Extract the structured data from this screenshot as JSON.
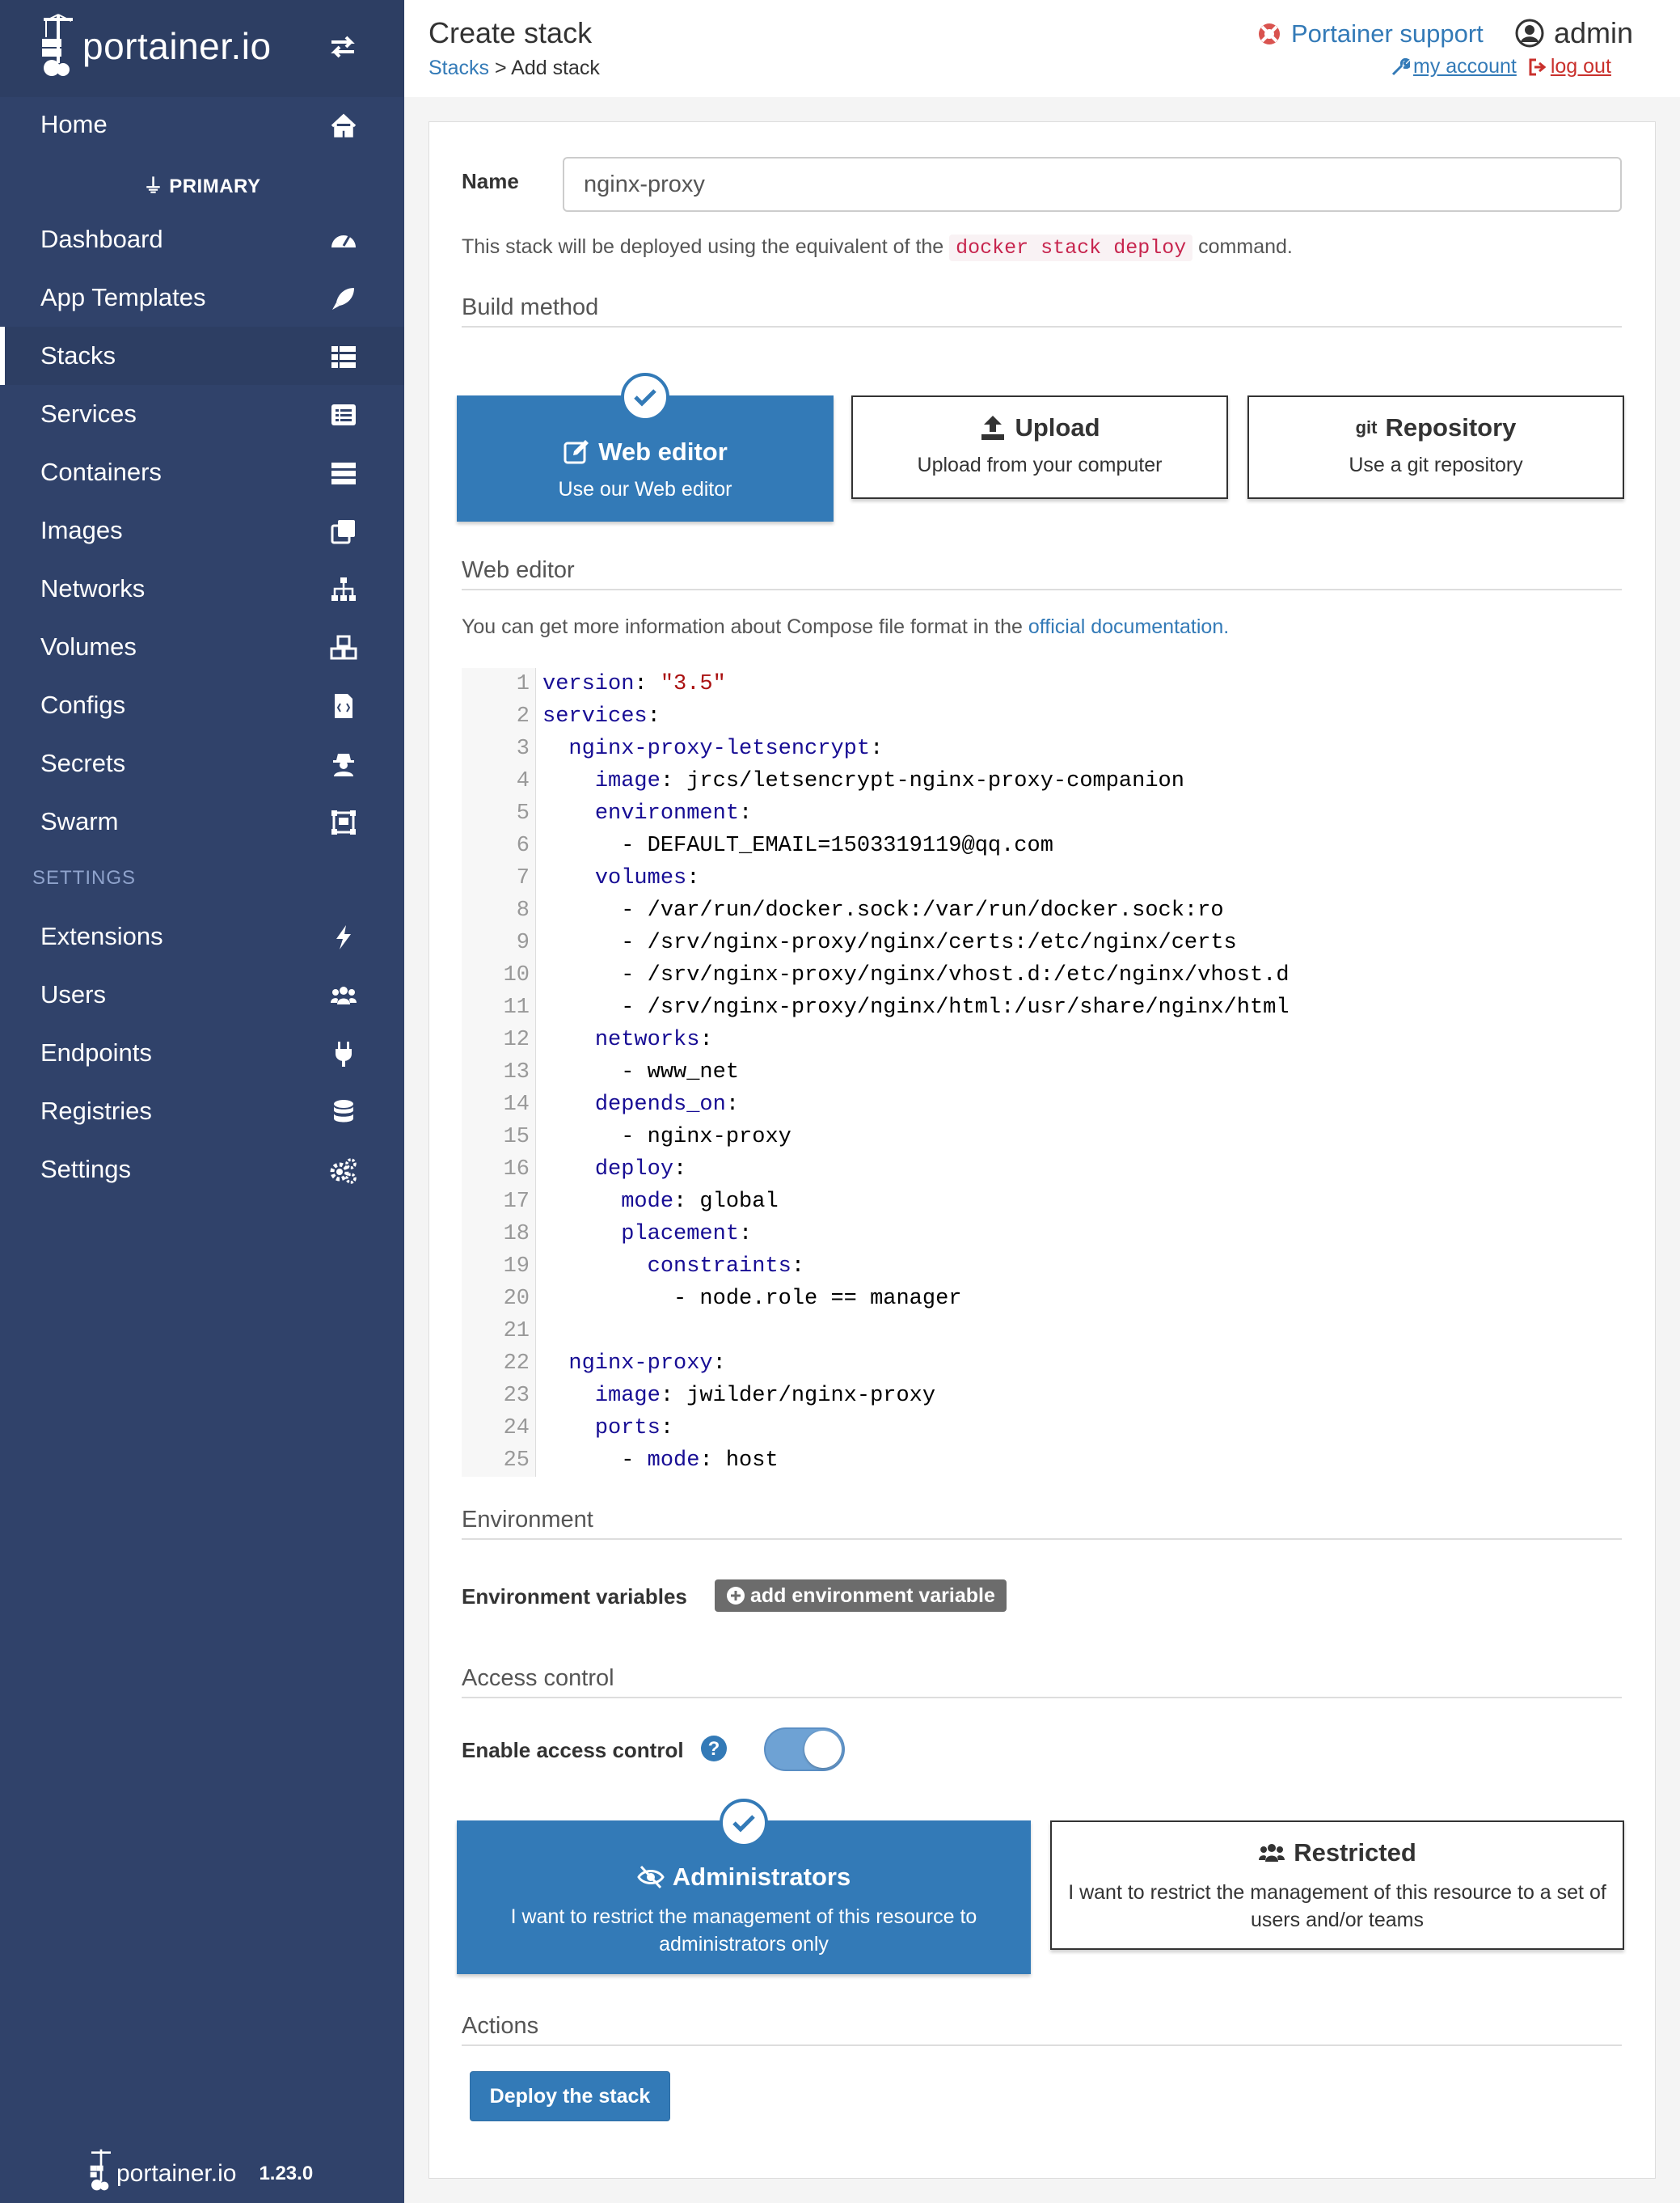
{
  "sidebar": {
    "brand": "portainer.io",
    "endpoint_label": "PRIMARY",
    "settings_heading": "SETTINGS",
    "items": [
      {
        "label": "Home",
        "icon": "home-icon"
      },
      {
        "label": "Dashboard",
        "icon": "tachometer-icon"
      },
      {
        "label": "App Templates",
        "icon": "rocket-icon"
      },
      {
        "label": "Stacks",
        "icon": "th-list-icon"
      },
      {
        "label": "Services",
        "icon": "list-alt-icon"
      },
      {
        "label": "Containers",
        "icon": "server-icon"
      },
      {
        "label": "Images",
        "icon": "clone-icon"
      },
      {
        "label": "Networks",
        "icon": "sitemap-icon"
      },
      {
        "label": "Volumes",
        "icon": "cubes-icon"
      },
      {
        "label": "Configs",
        "icon": "file-code-icon"
      },
      {
        "label": "Secrets",
        "icon": "user-secret-icon"
      },
      {
        "label": "Swarm",
        "icon": "object-group-icon"
      },
      {
        "label": "Extensions",
        "icon": "bolt-icon"
      },
      {
        "label": "Users",
        "icon": "users-icon"
      },
      {
        "label": "Endpoints",
        "icon": "plug-icon"
      },
      {
        "label": "Registries",
        "icon": "database-icon"
      },
      {
        "label": "Settings",
        "icon": "cogs-icon"
      }
    ],
    "active_item": "Stacks",
    "footer_brand": "portainer.io",
    "version": "1.23.0"
  },
  "header": {
    "title": "Create stack",
    "breadcrumb_link": "Stacks",
    "breadcrumb_current": " > Add stack",
    "support_label": "Portainer support",
    "user_name": "admin",
    "my_account": " my account ",
    "log_out": " log out"
  },
  "form": {
    "name_label": "Name",
    "name_value": "nginx-proxy",
    "deploy_hint_before": "This stack will be deployed using the equivalent of the",
    "deploy_hint_code": "docker stack deploy",
    "deploy_hint_after": "command."
  },
  "build_method": {
    "title": "Build method",
    "options": [
      {
        "label": "Web editor",
        "sub": "Use our Web editor",
        "icon": "edit-icon",
        "selected": true
      },
      {
        "label": "Upload",
        "sub": "Upload from your computer",
        "icon": "upload-icon",
        "selected": false
      },
      {
        "label": "Repository",
        "sub": "Use a git repository",
        "icon": "git-icon",
        "icon_text": "git",
        "selected": false
      }
    ]
  },
  "web_editor": {
    "title": "Web editor",
    "info_before": "You can get more information about Compose file format in the",
    "info_link": "official documentation.",
    "lines": [
      "1",
      "2",
      "3",
      "4",
      "5",
      "6",
      "7",
      "8",
      "9",
      "10",
      "11",
      "12",
      "13",
      "14",
      "15",
      "16",
      "17",
      "18",
      "19",
      "20",
      "21",
      "22",
      "23",
      "24",
      "25"
    ],
    "code": [
      {
        "k": "version",
        "rest": ": ",
        "s": "\"3.5\"",
        "indent": ""
      },
      {
        "k": "services",
        "rest": ":",
        "indent": ""
      },
      {
        "k": "nginx-proxy-letsencrypt",
        "rest": ":",
        "indent": "  "
      },
      {
        "k": "image",
        "rest": ": jrcs/letsencrypt-nginx-proxy-companion",
        "indent": "    "
      },
      {
        "k": "environment",
        "rest": ":",
        "indent": "    "
      },
      {
        "k": "",
        "rest": "- DEFAULT_EMAIL=1503319119@qq.com",
        "indent": "      "
      },
      {
        "k": "volumes",
        "rest": ":",
        "indent": "    "
      },
      {
        "k": "",
        "rest": "- /var/run/docker.sock:/var/run/docker.sock:ro",
        "indent": "      "
      },
      {
        "k": "",
        "rest": "- /srv/nginx-proxy/nginx/certs:/etc/nginx/certs",
        "indent": "      "
      },
      {
        "k": "",
        "rest": "- /srv/nginx-proxy/nginx/vhost.d:/etc/nginx/vhost.d",
        "indent": "      "
      },
      {
        "k": "",
        "rest": "- /srv/nginx-proxy/nginx/html:/usr/share/nginx/html",
        "indent": "      "
      },
      {
        "k": "networks",
        "rest": ":",
        "indent": "    "
      },
      {
        "k": "",
        "rest": "- www_net",
        "indent": "      "
      },
      {
        "k": "depends_on",
        "rest": ":",
        "indent": "    "
      },
      {
        "k": "",
        "rest": "- nginx-proxy",
        "indent": "      "
      },
      {
        "k": "deploy",
        "rest": ":",
        "indent": "    "
      },
      {
        "k": "mode",
        "rest": ": global",
        "indent": "      "
      },
      {
        "k": "placement",
        "rest": ":",
        "indent": "      "
      },
      {
        "k": "constraints",
        "rest": ":",
        "indent": "        "
      },
      {
        "k": "",
        "rest": "- node.role == manager",
        "indent": "          "
      },
      {
        "k": "",
        "rest": "",
        "indent": ""
      },
      {
        "k": "nginx-proxy",
        "rest": ":",
        "indent": "  "
      },
      {
        "k": "image",
        "rest": ": jwilder/nginx-proxy",
        "indent": "    "
      },
      {
        "k": "ports",
        "rest": ":",
        "indent": "    "
      },
      {
        "k": "mode",
        "rest": ": host",
        "indent": "      ",
        "dash": "- "
      }
    ]
  },
  "environment": {
    "title": "Environment",
    "vars_label": "Environment variables",
    "add_button": "add environment variable"
  },
  "access_control": {
    "title": "Access control",
    "enable_label": "Enable access control",
    "enabled": true,
    "options": [
      {
        "label": "Administrators",
        "sub": "I want to restrict the management of this resource to administrators only",
        "icon": "eye-slash-icon",
        "selected": true
      },
      {
        "label": "Restricted",
        "sub": "I want to restrict the management of this resource to a set of users and/or teams",
        "icon": "users-icon",
        "selected": false
      }
    ]
  },
  "actions": {
    "title": "Actions",
    "deploy_button": "Deploy the stack"
  },
  "colors": {
    "sidebar": "#30426a",
    "primary": "#337ab7",
    "danger": "#c9302c",
    "code_keyword": "#170d94",
    "code_string": "#aa1111"
  }
}
